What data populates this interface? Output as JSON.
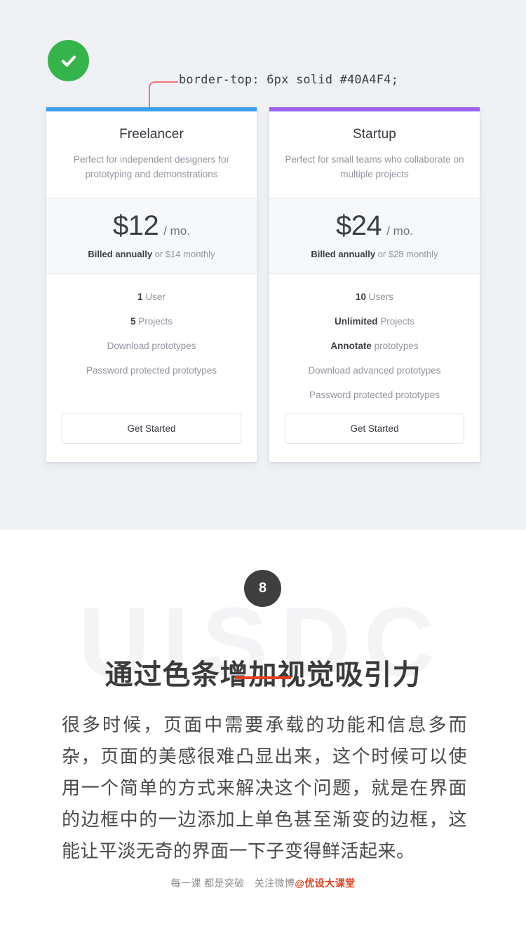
{
  "demo": {
    "status_icon": "check-circle-icon",
    "status_color": "#35b44b",
    "callout": {
      "text": "border-top: 6px solid #40A4F4;",
      "line_color": "#f4737e"
    },
    "cards": [
      {
        "accent": "#3d9ff0",
        "title": "Freelancer",
        "description": "Perfect for independent designers for prototyping and demonstrations",
        "price": "$12",
        "period": "/ mo.",
        "billing_bold": "Billed annually",
        "billing_rest": " or $14 monthly",
        "features": [
          {
            "bold": "1",
            "rest": " User"
          },
          {
            "bold": "5",
            "rest": " Projects"
          },
          {
            "bold": "",
            "rest": "Download prototypes"
          },
          {
            "bold": "",
            "rest": "Password  protected prototypes"
          }
        ],
        "cta": "Get Started"
      },
      {
        "accent": "#9b63f0",
        "title": "Startup",
        "description": "Perfect for small teams who collaborate on multiple projects",
        "price": "$24",
        "period": "/ mo.",
        "billing_bold": "Billed annually",
        "billing_rest": " or $28 monthly",
        "features": [
          {
            "bold": "10",
            "rest": " Users"
          },
          {
            "bold": "Unlimited",
            "rest": " Projects"
          },
          {
            "bold": "Annotate",
            "rest": " prototypes"
          },
          {
            "bold": "",
            "rest": "Download advanced prototypes"
          },
          {
            "bold": "",
            "rest": "Password protected prototypes"
          }
        ],
        "cta": "Get Started"
      }
    ]
  },
  "article": {
    "step_number": "8",
    "watermark": "UISDC",
    "title": "通过色条增加视觉吸引力",
    "rule_color": "#e8401c",
    "body": "很多时候，页面中需要承载的功能和信息多而杂，页面的美感很难凸显出来，这个时候可以使用一个简单的方式来解决这个问题，就是在界面的边框中的一边添加上单色甚至渐变的边框，这能让平淡无奇的界面一下子变得鲜活起来。",
    "footer_left": "每一课 都是突破",
    "footer_right": "关注微博",
    "footer_handle": "@优设大课堂"
  }
}
